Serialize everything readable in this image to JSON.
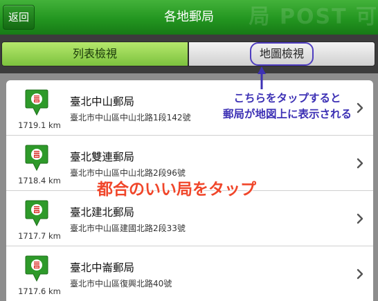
{
  "header": {
    "back_label": "返回",
    "title": "各地郵局",
    "decoration_text": "局 POST 可"
  },
  "tabs": [
    {
      "label": "列表檢視",
      "selected": true
    },
    {
      "label": "地圖檢視",
      "selected": false
    }
  ],
  "offices": [
    {
      "name": "臺北中山郵局",
      "address": "臺北市中山區中山北路1段142號",
      "distance": "1719.1 km"
    },
    {
      "name": "臺北雙連郵局",
      "address": "臺北市中山區中山北路2段96號",
      "distance": "1718.4 km"
    },
    {
      "name": "臺北建北郵局",
      "address": "臺北市中山區建國北路2段33號",
      "distance": "1717.7 km"
    },
    {
      "name": "臺北中崙郵局",
      "address": "臺北市中山區復興北路40號",
      "distance": "1717.6 km"
    }
  ],
  "annotations": {
    "tap_line1": "こちらをタップすると",
    "tap_line2": "郵局が地図上に表示される",
    "main": "都合のいい局をタップ"
  },
  "colors": {
    "header_green": "#239620",
    "tab_selected_green": "#8fd04a",
    "pin_green": "#2e9a2a",
    "annotation_blue": "#3d31b5",
    "annotation_orange": "#f0462a"
  },
  "icons": {
    "pin": "post-office-pin-icon",
    "chevron": "chevron-right-icon",
    "arrow": "arrow-up-icon"
  }
}
